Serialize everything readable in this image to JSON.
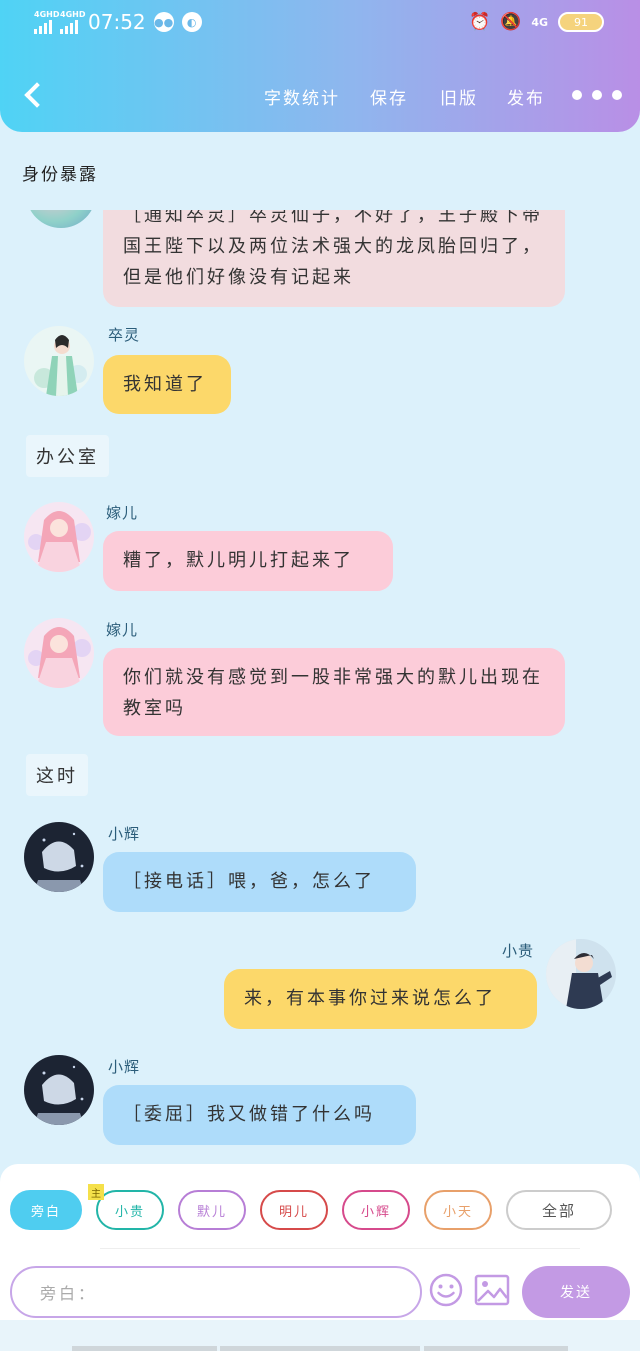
{
  "status_bar": {
    "net1": "4GHD",
    "net2": "4GHD",
    "time": "07:52",
    "net_right": "4G",
    "battery": "91"
  },
  "nav": {
    "word_count": "字数统计",
    "save": "保存",
    "old_version": "旧版",
    "publish": "发布"
  },
  "chapter_title": "身份暴露",
  "messages": [
    {
      "text": "［通知卒灵］卒灵仙子，不好了，王子殿下带国王陛下以及两位法术强大的龙凤胎回归了，但是他们好像没有记起来"
    },
    {
      "name": "卒灵",
      "text": "我知道了"
    },
    {
      "narration": "办公室"
    },
    {
      "name": "嫁儿",
      "text": "糟了，默儿明儿打起来了"
    },
    {
      "name": "嫁儿",
      "text": "你们就没有感觉到一股非常强大的默儿出现在教室吗"
    },
    {
      "narration": "这时"
    },
    {
      "name": "小辉",
      "text": "［接电话］喂，爸，怎么了"
    },
    {
      "name": "小贵",
      "text": "来，有本事你过来说怎么了"
    },
    {
      "name": "小辉",
      "text": "［委屈］我又做错了什么吗"
    }
  ],
  "roles": {
    "lead_badge": "主",
    "items": [
      {
        "label": "旁白",
        "color": "#4fcdf0",
        "active": true
      },
      {
        "label": "小贵",
        "color": "#22b5a8"
      },
      {
        "label": "默儿",
        "color": "#b77ed6"
      },
      {
        "label": "明儿",
        "color": "#d64a4a"
      },
      {
        "label": "小辉",
        "color": "#d64a8c"
      },
      {
        "label": "小天",
        "color": "#e8a06a"
      },
      {
        "label": "全部",
        "color": "#cccccc"
      }
    ]
  },
  "input": {
    "placeholder": "旁白："
  },
  "send_label": "发送",
  "colors": {
    "pink_bubble_top": "#f2dcdf",
    "pink_bubble": "#fcccd9",
    "yellow_bubble": "#fcd86a",
    "blue_bubble": "#aedcfa",
    "accent_purple": "#c39ae4"
  }
}
